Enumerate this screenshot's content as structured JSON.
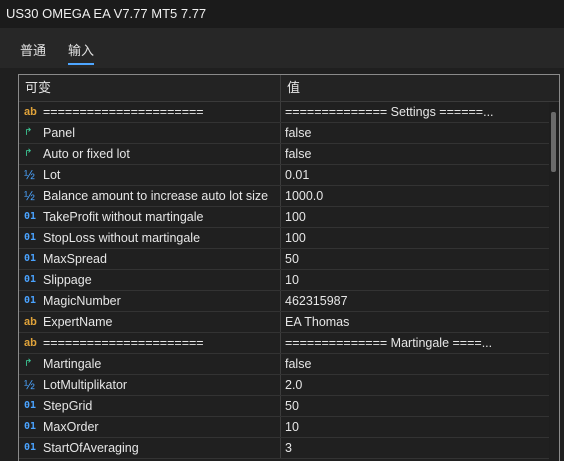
{
  "window": {
    "title": "US30 OMEGA EA V7.77 MT5 7.77"
  },
  "tabs": [
    {
      "label": "普通",
      "active": false
    },
    {
      "label": "输入",
      "active": true
    }
  ],
  "table": {
    "headers": {
      "variable": "可变",
      "value": "值"
    },
    "rows": [
      {
        "icon": "ab-string-icon",
        "name": "======================",
        "value": "============== Settings ======..."
      },
      {
        "icon": "bool-arrow-icon",
        "name": "Panel",
        "value": "false"
      },
      {
        "icon": "bool-arrow-icon",
        "name": "Auto or fixed lot",
        "value": "false"
      },
      {
        "icon": "half-double-icon",
        "name": "Lot",
        "value": "0.01"
      },
      {
        "icon": "half-double-icon",
        "name": "Balance amount to increase auto lot size",
        "value": "1000.0"
      },
      {
        "icon": "int-01-icon",
        "name": "TakeProfit without martingale",
        "value": "100"
      },
      {
        "icon": "int-01-icon",
        "name": "StopLoss without martingale",
        "value": "100"
      },
      {
        "icon": "int-01-icon",
        "name": "MaxSpread",
        "value": "50"
      },
      {
        "icon": "int-01-icon",
        "name": "Slippage",
        "value": "10"
      },
      {
        "icon": "int-01-icon",
        "name": "MagicNumber",
        "value": "462315987"
      },
      {
        "icon": "ab-string-icon",
        "name": "ExpertName",
        "value": "EA Thomas"
      },
      {
        "icon": "ab-string-icon",
        "name": "======================",
        "value": "============== Martingale ====..."
      },
      {
        "icon": "bool-arrow-icon",
        "name": "Martingale",
        "value": "false"
      },
      {
        "icon": "half-double-icon",
        "name": "LotMultiplikator",
        "value": "2.0"
      },
      {
        "icon": "int-01-icon",
        "name": "StepGrid",
        "value": "50"
      },
      {
        "icon": "int-01-icon",
        "name": "MaxOrder",
        "value": "10"
      },
      {
        "icon": "int-01-icon",
        "name": "StartOfAveraging",
        "value": "3"
      }
    ]
  },
  "icon_glyphs": {
    "ab-string-icon": "ab",
    "bool-arrow-icon": "↱",
    "half-double-icon": "½",
    "int-01-icon": "01"
  },
  "colors": {
    "accent": "#4ea6ff",
    "string_icon": "#e0a33a",
    "number_icon": "#4aa3ff",
    "bool_icon": "#3ecf9a"
  }
}
